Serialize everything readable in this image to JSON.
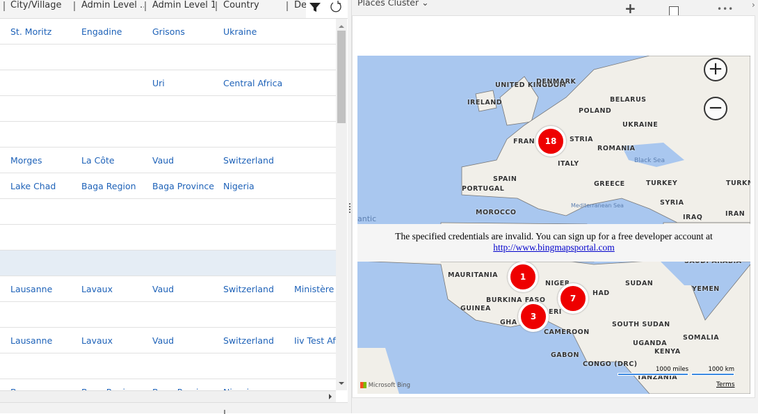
{
  "grid": {
    "columns": [
      "City/Village",
      "Admin Level ...",
      "Admin Level 1...",
      "Country",
      "De"
    ],
    "rows": [
      [
        "St. Moritz",
        "Engadine",
        "Grisons",
        "Ukraine",
        ""
      ],
      [
        "",
        "",
        "",
        "",
        ""
      ],
      [
        "",
        "",
        "Uri",
        "Central Africa",
        ""
      ],
      [
        "",
        "",
        "",
        "",
        ""
      ],
      [
        "",
        "",
        "",
        "",
        ""
      ],
      [
        "Morges",
        "La Côte",
        "Vaud",
        "Switzerland",
        ""
      ],
      [
        "Lake Chad",
        "Baga Region",
        "Baga Province",
        "Nigeria",
        ""
      ],
      [
        "",
        "",
        "",
        "",
        ""
      ],
      [
        "",
        "",
        "",
        "",
        ""
      ],
      [
        "",
        "",
        "",
        "",
        ""
      ],
      [
        "Lausanne",
        "Lavaux",
        "Vaud",
        "Switzerland",
        "Ministère c"
      ],
      [
        "",
        "",
        "",
        "",
        ""
      ],
      [
        "Lausanne",
        "Lavaux",
        "Vaud",
        "Switzerland",
        "Iiv Test Aft"
      ],
      [
        "",
        "",
        "",
        "",
        ""
      ],
      [
        "B...",
        "Baga Region",
        "Baga Province",
        "Nigeria",
        ""
      ]
    ],
    "selected_row": 9,
    "filter_icon": "filter-icon",
    "refresh_icon": "refresh-icon"
  },
  "panel": {
    "title": "Places Cluster",
    "add_icon": "plus-icon",
    "popout_icon": "popout-icon",
    "more_icon": "ellipsis-icon"
  },
  "map": {
    "labels": [
      "UNITED KINGDOM",
      "DENMARK",
      "IRELAND",
      "BELARUS",
      "POLAND",
      "UKRAINE",
      "FRAN",
      "STRIA",
      "ROMANIA",
      "ITALY",
      "SPAIN",
      "PORTUGAL",
      "GREECE",
      "TURKEY",
      "TURKME",
      "MOROCCO",
      "SYRIA",
      "IRAQ",
      "IRAN",
      "MAURITANIA",
      "NIGER",
      "HAD",
      "SUDAN",
      "BURKINA FASO",
      "GUINEA",
      "GHA",
      "ERI",
      "SOUTH SUDAN",
      "CAMEROON",
      "SOMALIA",
      "UGANDA",
      "KENYA",
      "GABON",
      "CONGO (DRC)",
      "TANZANIA",
      "YEMEN",
      "SAUDI ARABIA"
    ],
    "seas": [
      "Black Sea",
      "Mediterranean Sea",
      "antic"
    ],
    "clusters": [
      18,
      1,
      7,
      3
    ],
    "error_text": "The specified credentials are invalid. You can sign up for a free developer account at",
    "error_link": "http://www.bingmapsportal.com",
    "scale_miles": "1000 miles",
    "scale_km": "1000 km",
    "terms": "Terms",
    "brand": "Microsoft Bing",
    "zoom_in": "+",
    "zoom_out": "−"
  }
}
